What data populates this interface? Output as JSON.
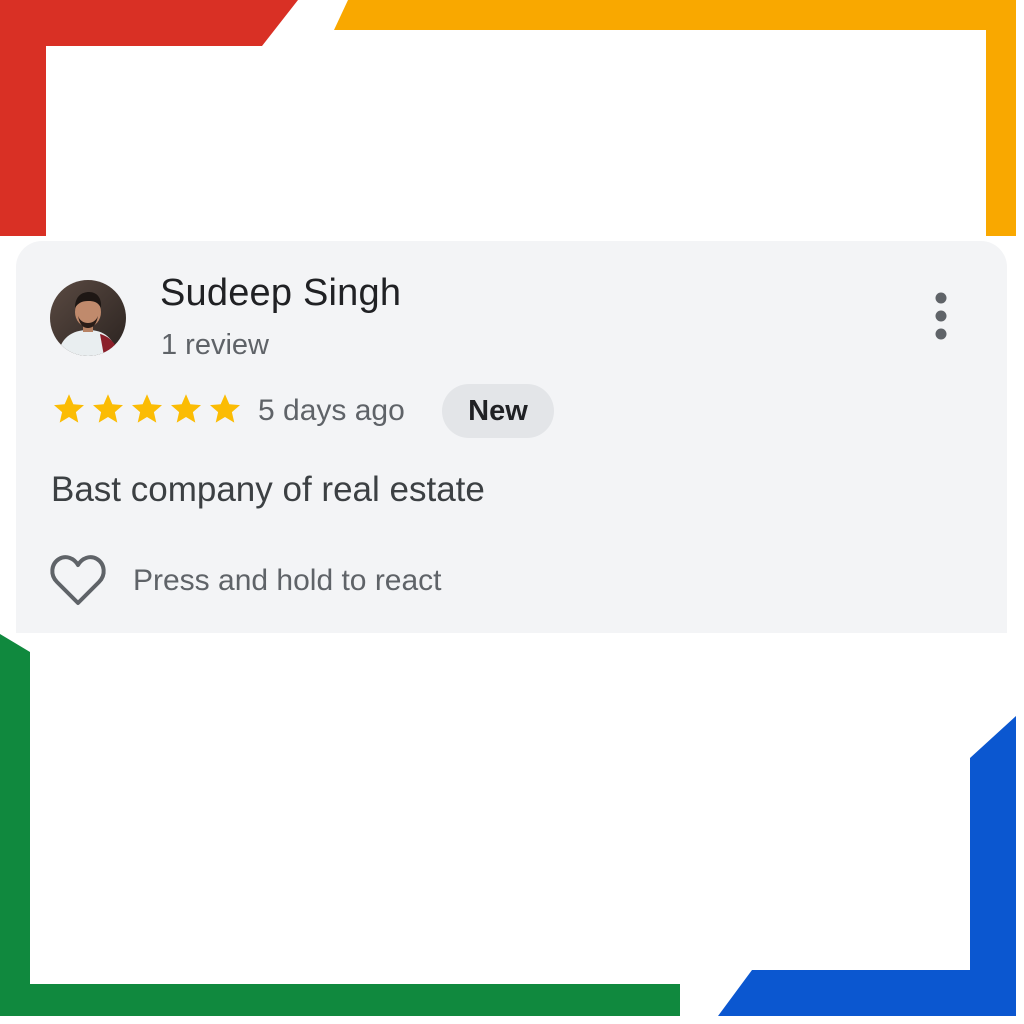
{
  "colors": {
    "brand_red": "#d93025",
    "brand_yellow": "#f9a800",
    "brand_green": "#10893e",
    "brand_blue": "#0b57d0",
    "card_background": "#f3f4f6",
    "star_color": "#fbbc04"
  },
  "review": {
    "reviewer_name": "Sudeep Singh",
    "review_count": "1 review",
    "rating": 5,
    "max_rating": 5,
    "date": "5 days ago",
    "badge": "New",
    "text": "Bast company of real estate",
    "react_hint": "Press and hold to react",
    "avatar_icon": "profile-photo",
    "more_icon": "more-vert-icon",
    "react_icon": "heart-outline-icon"
  }
}
